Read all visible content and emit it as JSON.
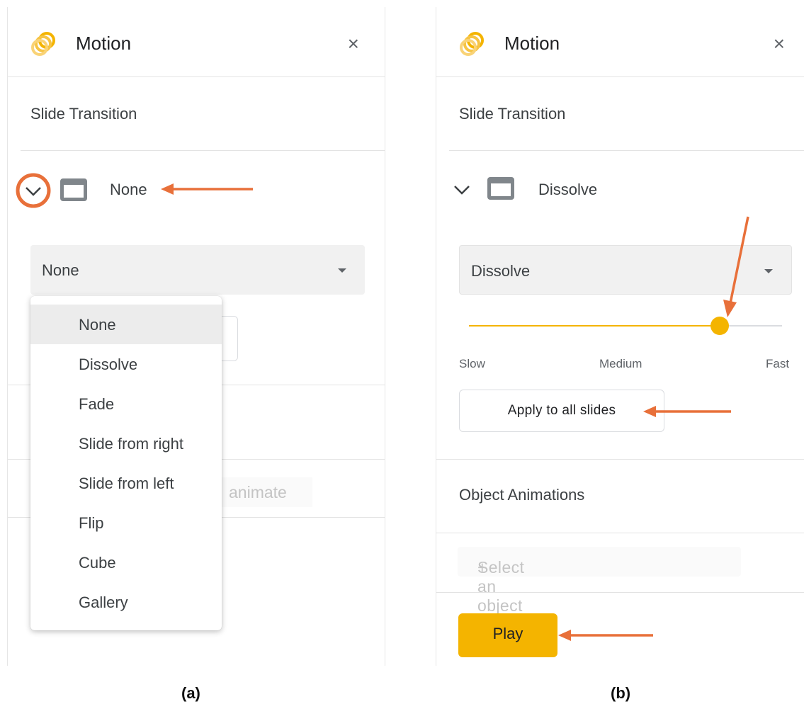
{
  "panel_a": {
    "title": "Motion",
    "close_icon": "×",
    "section_title": "Slide Transition",
    "transition_name": "None",
    "select_value": "None",
    "menu_options": [
      "None",
      "Dissolve",
      "Fade",
      "Slide from right",
      "Slide from left",
      "Flip",
      "Cube",
      "Gallery"
    ],
    "selected_option": "None",
    "partial_text": "animate"
  },
  "panel_b": {
    "title": "Motion",
    "close_icon": "×",
    "section_title": "Slide Transition",
    "transition_name": "Dissolve",
    "select_value": "Dissolve",
    "speed": {
      "slow": "Slow",
      "medium": "Medium",
      "fast": "Fast",
      "value_fraction": 0.8
    },
    "apply_button": "Apply to all slides",
    "object_animations_title": "Object Animations",
    "add_animation_plus": "+",
    "add_animation": "Select an object to animate",
    "play_button": "Play"
  },
  "captions": {
    "a": "(a)",
    "b": "(b)"
  },
  "colors": {
    "accent_orange": "#e8703a",
    "slider_yellow": "#f4b400",
    "play_yellow": "#f4b400"
  },
  "icons": {
    "logo": "motion-logo-icon",
    "close": "close-icon",
    "chevron": "chevron-down-icon",
    "slide": "slide-thumbnail-icon"
  }
}
